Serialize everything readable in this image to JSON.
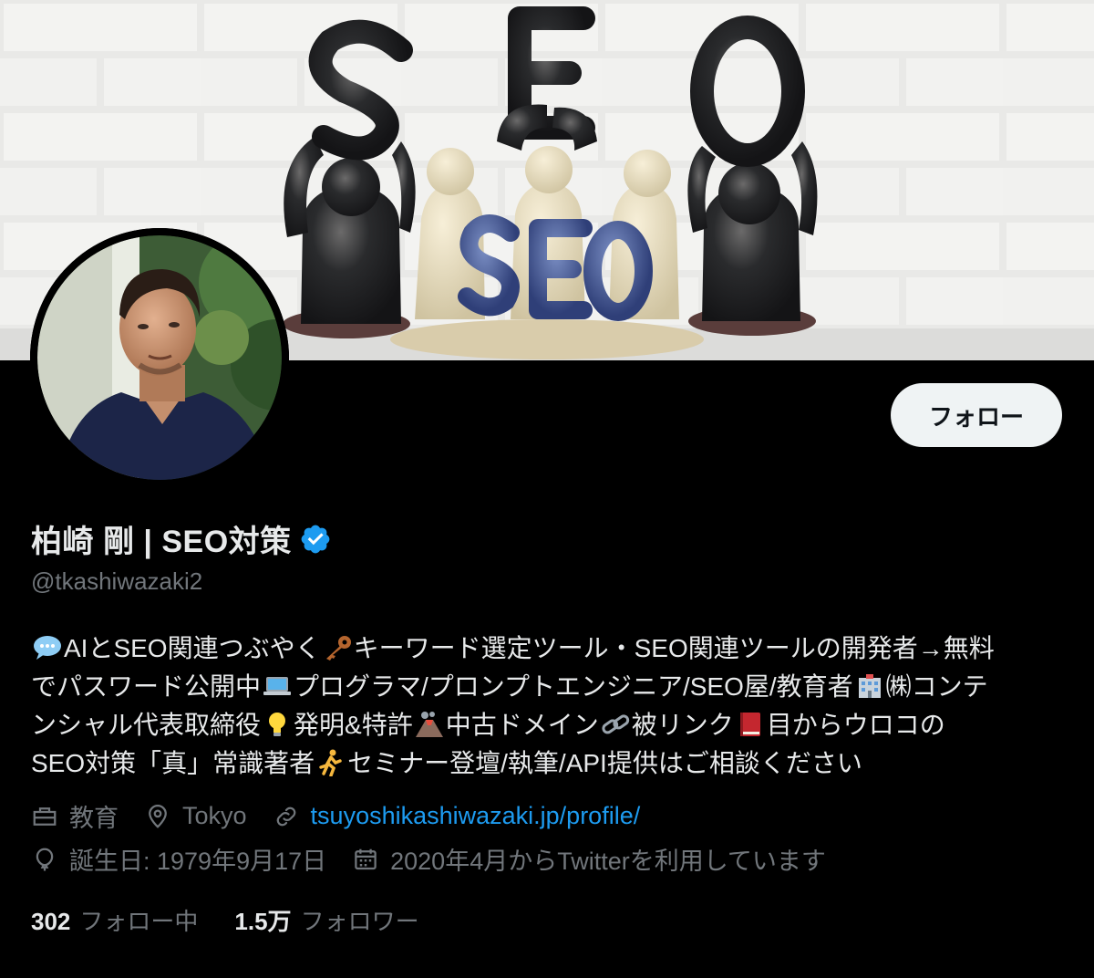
{
  "banner": {
    "alt_text": "SEO",
    "icon": "seo-clay-figures-banner"
  },
  "profile": {
    "display_name": "柏崎 剛 | SEO対策",
    "handle": "@tkashiwazaki2",
    "verified_icon": "verified-badge-icon",
    "verified_color": "#1d9bf0"
  },
  "actions": {
    "follow_label": "フォロー"
  },
  "bio": {
    "line1_a": "AIとSEO関連つぶやく",
    "line1_b": "キーワード選定ツール・SEO関連ツールの開発者→無料",
    "line2_a": "でパスワード公開中",
    "line2_b": "プログラマ/プロンプトエンジニア/SEO屋/教育者",
    "line2_c": "㈱コンテ",
    "line3_a": "ンシャル代表取締役",
    "line3_b": "発明&特許",
    "line3_c": "中古ドメイン",
    "line3_d": "被リンク",
    "line3_e": "目からウロコの",
    "line4_a": "SEO対策「真」常識著者",
    "line4_b": "セミナー登壇/執筆/API提供はご相談ください"
  },
  "meta": {
    "category": "教育",
    "location": "Tokyo",
    "website": "tsuyoshikashiwazaki.jp/profile/",
    "birthday": "誕生日: 1979年9月17日",
    "joined": "2020年4月からTwitterを利用しています"
  },
  "counts": {
    "following_num": "302",
    "following_label": "フォロー中",
    "followers_num": "1.5万",
    "followers_label": "フォロワー"
  },
  "colors": {
    "background": "#000000",
    "primary_text": "#e7e9ea",
    "secondary_text": "#71767b",
    "link": "#1d9bf0",
    "follow_button_bg": "#eff3f4"
  }
}
